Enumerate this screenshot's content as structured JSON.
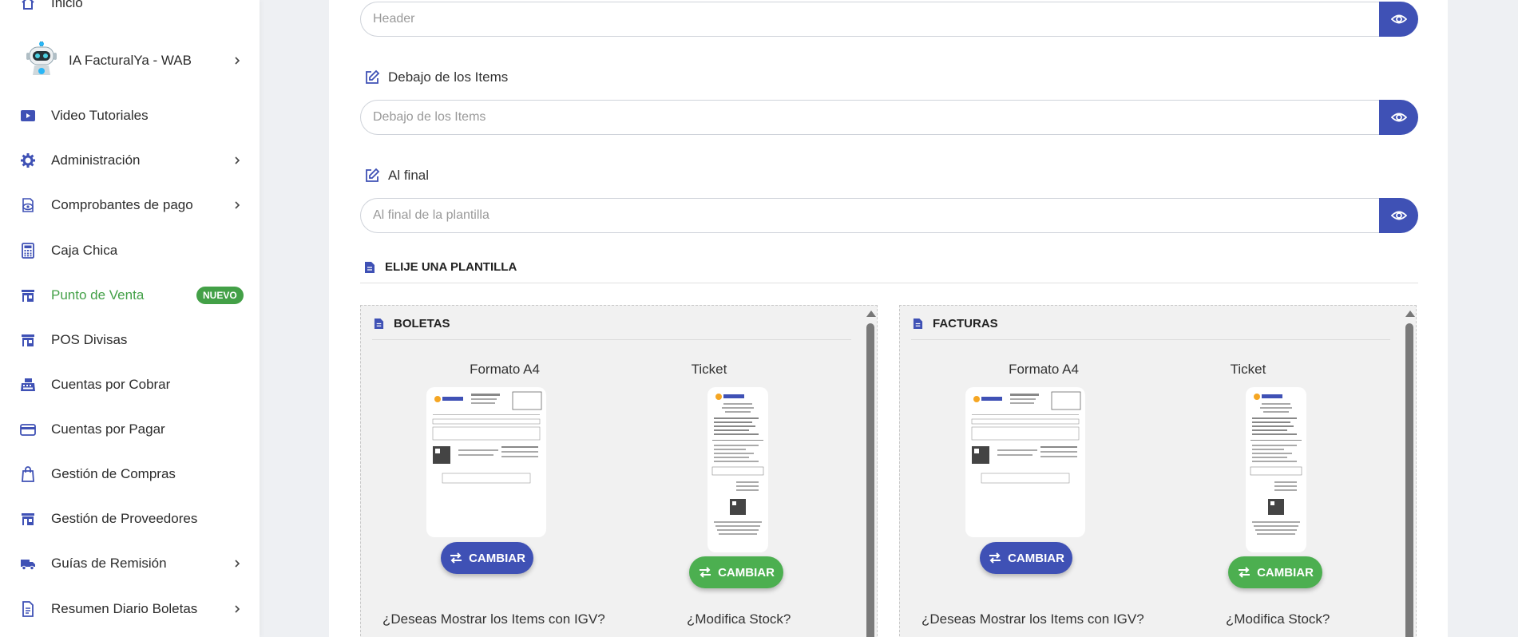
{
  "sidebar": {
    "top_item": {
      "label": "Inicio",
      "icon": "home-icon"
    },
    "items": [
      {
        "label": "IA FacturalYa - WAB",
        "icon": "robot-icon",
        "chevron": true
      },
      {
        "label": "Video Tutoriales",
        "icon": "video-icon",
        "chevron": false
      },
      {
        "label": "Administración",
        "icon": "gear-icon",
        "chevron": true
      },
      {
        "label": "Comprobantes de pago",
        "icon": "eye-receipt-icon",
        "chevron": true
      },
      {
        "label": "Caja Chica",
        "icon": "calculator-icon",
        "chevron": false
      },
      {
        "label": "Punto de Venta",
        "icon": "store-icon",
        "chevron": false,
        "active": true,
        "badge": "NUEVO"
      },
      {
        "label": "POS Divisas",
        "icon": "store-icon",
        "chevron": false
      },
      {
        "label": "Cuentas por Cobrar",
        "icon": "cash-register-icon",
        "chevron": false
      },
      {
        "label": "Cuentas por Pagar",
        "icon": "credit-card-icon",
        "chevron": false
      },
      {
        "label": "Gestión de Compras",
        "icon": "shopping-bag-icon",
        "chevron": false
      },
      {
        "label": "Gestión de Proveedores",
        "icon": "store-icon",
        "chevron": false
      },
      {
        "label": "Guías de Remisión",
        "icon": "truck-icon",
        "chevron": true
      },
      {
        "label": "Resumen Diario Boletas",
        "icon": "document-icon",
        "chevron": true
      }
    ]
  },
  "form": {
    "header_field": {
      "placeholder": "Header",
      "value": ""
    },
    "items_section": {
      "label": "Debajo de los Items",
      "placeholder": "Debajo de los Items",
      "value": ""
    },
    "end_section": {
      "label": "Al final",
      "placeholder": "Al final de la plantilla",
      "value": ""
    }
  },
  "templates": {
    "heading": "ELIJE UNA PLANTILLA",
    "panels": [
      {
        "title": "BOLETAS",
        "a4_label": "Formato A4",
        "ticket_label": "Ticket",
        "a4_button": "CAMBIAR",
        "ticket_button": "CAMBIAR",
        "question_igv": "¿Deseas Mostrar los Items con IGV?",
        "question_stock": "¿Modifica Stock?"
      },
      {
        "title": "FACTURAS",
        "a4_label": "Formato A4",
        "ticket_label": "Ticket",
        "a4_button": "CAMBIAR",
        "ticket_button": "CAMBIAR",
        "question_igv": "¿Deseas Mostrar los Items con IGV?",
        "question_stock": "¿Modifica Stock?"
      }
    ]
  },
  "colors": {
    "primary": "#3f51b5",
    "success": "#4caf50",
    "active_nav": "#43a047",
    "icon": "#3f51b5"
  }
}
